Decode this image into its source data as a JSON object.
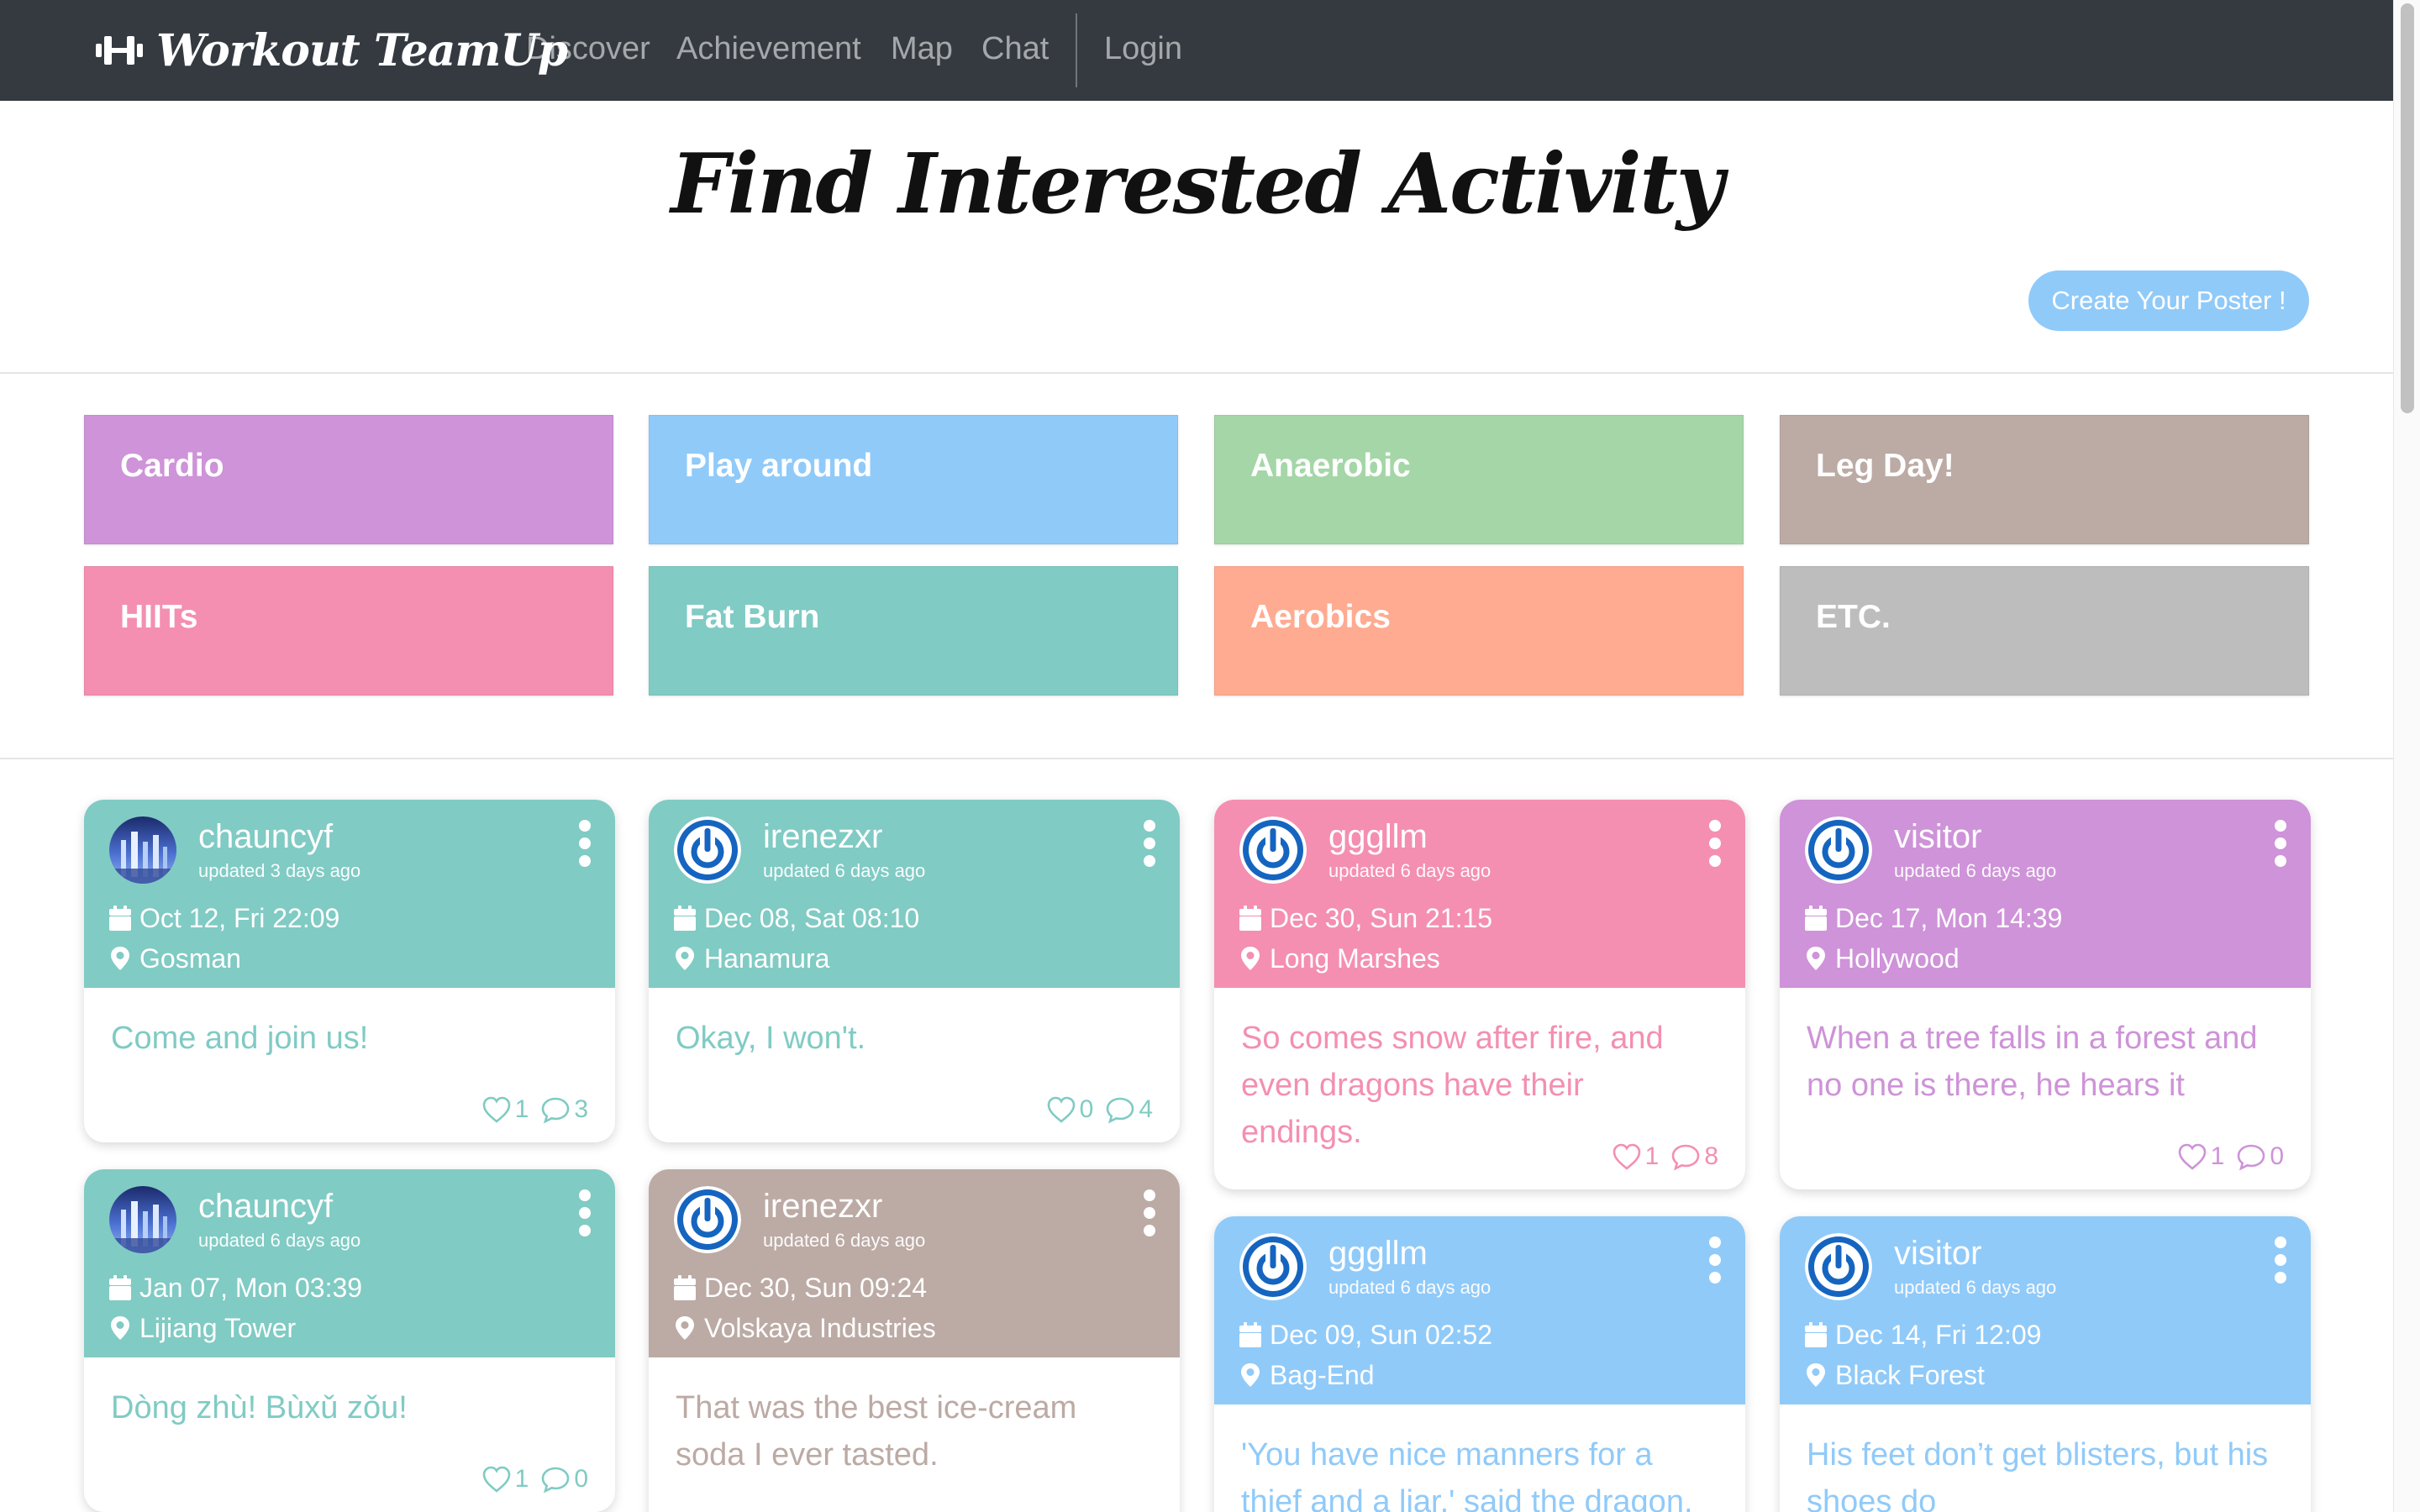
{
  "navbar": {
    "brand": "Workout TeamUp",
    "links": [
      "Discover",
      "Achievement",
      "Map",
      "Chat",
      "Login"
    ]
  },
  "header": {
    "title": "Find Interested Activity",
    "create_button": "Create Your Poster !"
  },
  "categories": [
    {
      "label": "Cardio",
      "color": "#ce93d8"
    },
    {
      "label": "Play around",
      "color": "#90caf9"
    },
    {
      "label": "Anaerobic",
      "color": "#a5d6a7"
    },
    {
      "label": "Leg Day!",
      "color": "#bcaaa4"
    },
    {
      "label": "HIITs",
      "color": "#f48fb1"
    },
    {
      "label": "Fat Burn",
      "color": "#80cbc4"
    },
    {
      "label": "Aerobics",
      "color": "#ffab91"
    },
    {
      "label": "ETC.",
      "color": "#bdbdbd"
    }
  ],
  "posters": [
    {
      "user": "chauncyf",
      "updated": "updated 3 days ago",
      "date": "Oct 12, Fri 22:09",
      "location": "Gosman",
      "message": "Come and join us!",
      "likes": "1",
      "comments": "3",
      "color": "#80cbc4",
      "avatar": "photo-avatar"
    },
    {
      "user": "irenezxr",
      "updated": "updated 6 days ago",
      "date": "Dec 08, Sat 08:10",
      "location": "Hanamura",
      "message": "Okay, I won't.",
      "likes": "0",
      "comments": "4",
      "color": "#80cbc4",
      "avatar": "power-avatar"
    },
    {
      "user": "gggllm",
      "updated": "updated 6 days ago",
      "date": "Dec 30, Sun 21:15",
      "location": "Long Marshes",
      "message": "So comes snow after fire, and even dragons have their endings.",
      "likes": "1",
      "comments": "8",
      "color": "#f48fb1",
      "avatar": "power-avatar"
    },
    {
      "user": "visitor",
      "updated": "updated 6 days ago",
      "date": "Dec 17, Mon 14:39",
      "location": "Hollywood",
      "message": "When a tree falls in a forest and no one is there, he hears it",
      "likes": "1",
      "comments": "0",
      "color": "#ce93d8",
      "avatar": "power-avatar"
    },
    {
      "user": "chauncyf",
      "updated": "updated 6 days ago",
      "date": "Jan 07, Mon 03:39",
      "location": "Lijiang Tower",
      "message": "Dòng zhù! Bùxǔ zǒu!",
      "likes": "1",
      "comments": "0",
      "color": "#80cbc4",
      "avatar": "photo-avatar"
    },
    {
      "user": "irenezxr",
      "updated": "updated 6 days ago",
      "date": "Dec 30, Sun 09:24",
      "location": "Volskaya Industries",
      "message": "That was the best ice-cream soda I ever tasted.",
      "likes": "",
      "comments": "",
      "color": "#bcaaa4",
      "avatar": "power-avatar"
    },
    {
      "user": "gggllm",
      "updated": "updated 6 days ago",
      "date": "Dec 09, Sun 02:52",
      "location": "Bag-End",
      "message": "'You have nice manners for a thief and a liar,' said the dragon.",
      "likes": "",
      "comments": "",
      "color": "#90caf9",
      "avatar": "power-avatar"
    },
    {
      "user": "visitor",
      "updated": "updated 6 days ago",
      "date": "Dec 14, Fri 12:09",
      "location": "Black Forest",
      "message": "His feet don’t get blisters, but his shoes do",
      "likes": "",
      "comments": "",
      "color": "#90caf9",
      "avatar": "power-avatar"
    }
  ]
}
